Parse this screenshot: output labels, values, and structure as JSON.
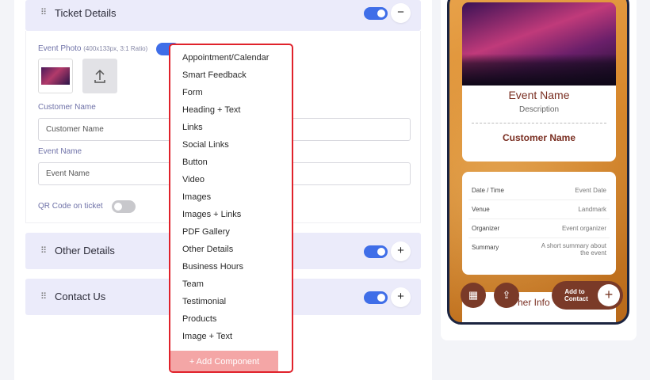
{
  "sections": {
    "ticket_details": {
      "title": "Ticket Details",
      "enabled": true,
      "action_icon": "minus"
    },
    "other_details": {
      "title": "Other Details",
      "enabled": true,
      "action_icon": "plus"
    },
    "contact_us": {
      "title": "Contact Us",
      "enabled": true,
      "action_icon": "plus"
    }
  },
  "ticket_form": {
    "event_photo_label": "Event Photo",
    "event_photo_hint": "(400x133px, 3:1 Ratio)",
    "customer_name_label": "Customer Name",
    "customer_name_value": "Customer Name",
    "event_name_label": "Event Name",
    "event_name_value": "Event Name",
    "qr_code_label": "QR Code on ticket",
    "qr_code_enabled": false
  },
  "component_menu": {
    "items": [
      "Appointment/Calendar",
      "Smart Feedback",
      "Form",
      "Heading + Text",
      "Links",
      "Social Links",
      "Button",
      "Video",
      "Images",
      "Images + Links",
      "PDF Gallery",
      "Other Details",
      "Business Hours",
      "Team",
      "Testimonial",
      "Products",
      "Image + Text"
    ],
    "add_button": "+ Add Component"
  },
  "preview": {
    "event_name": "Event Name",
    "description": "Description",
    "customer_name": "Customer Name",
    "rows": [
      {
        "label": "Date / Time",
        "value": "Event Date"
      },
      {
        "label": "Venue",
        "value": "Landmark"
      },
      {
        "label": "Organizer",
        "value": "Event organizer"
      },
      {
        "label": "Summary",
        "value": "A short summary about the event"
      }
    ],
    "add_to_contact": "Add to Contact",
    "other_info_partial": "her Info"
  },
  "colors": {
    "accent_blue": "#3f6ee8",
    "section_bg": "#ebebfa",
    "dropdown_border": "#e0222b",
    "brand_brown": "#7a2f22"
  }
}
